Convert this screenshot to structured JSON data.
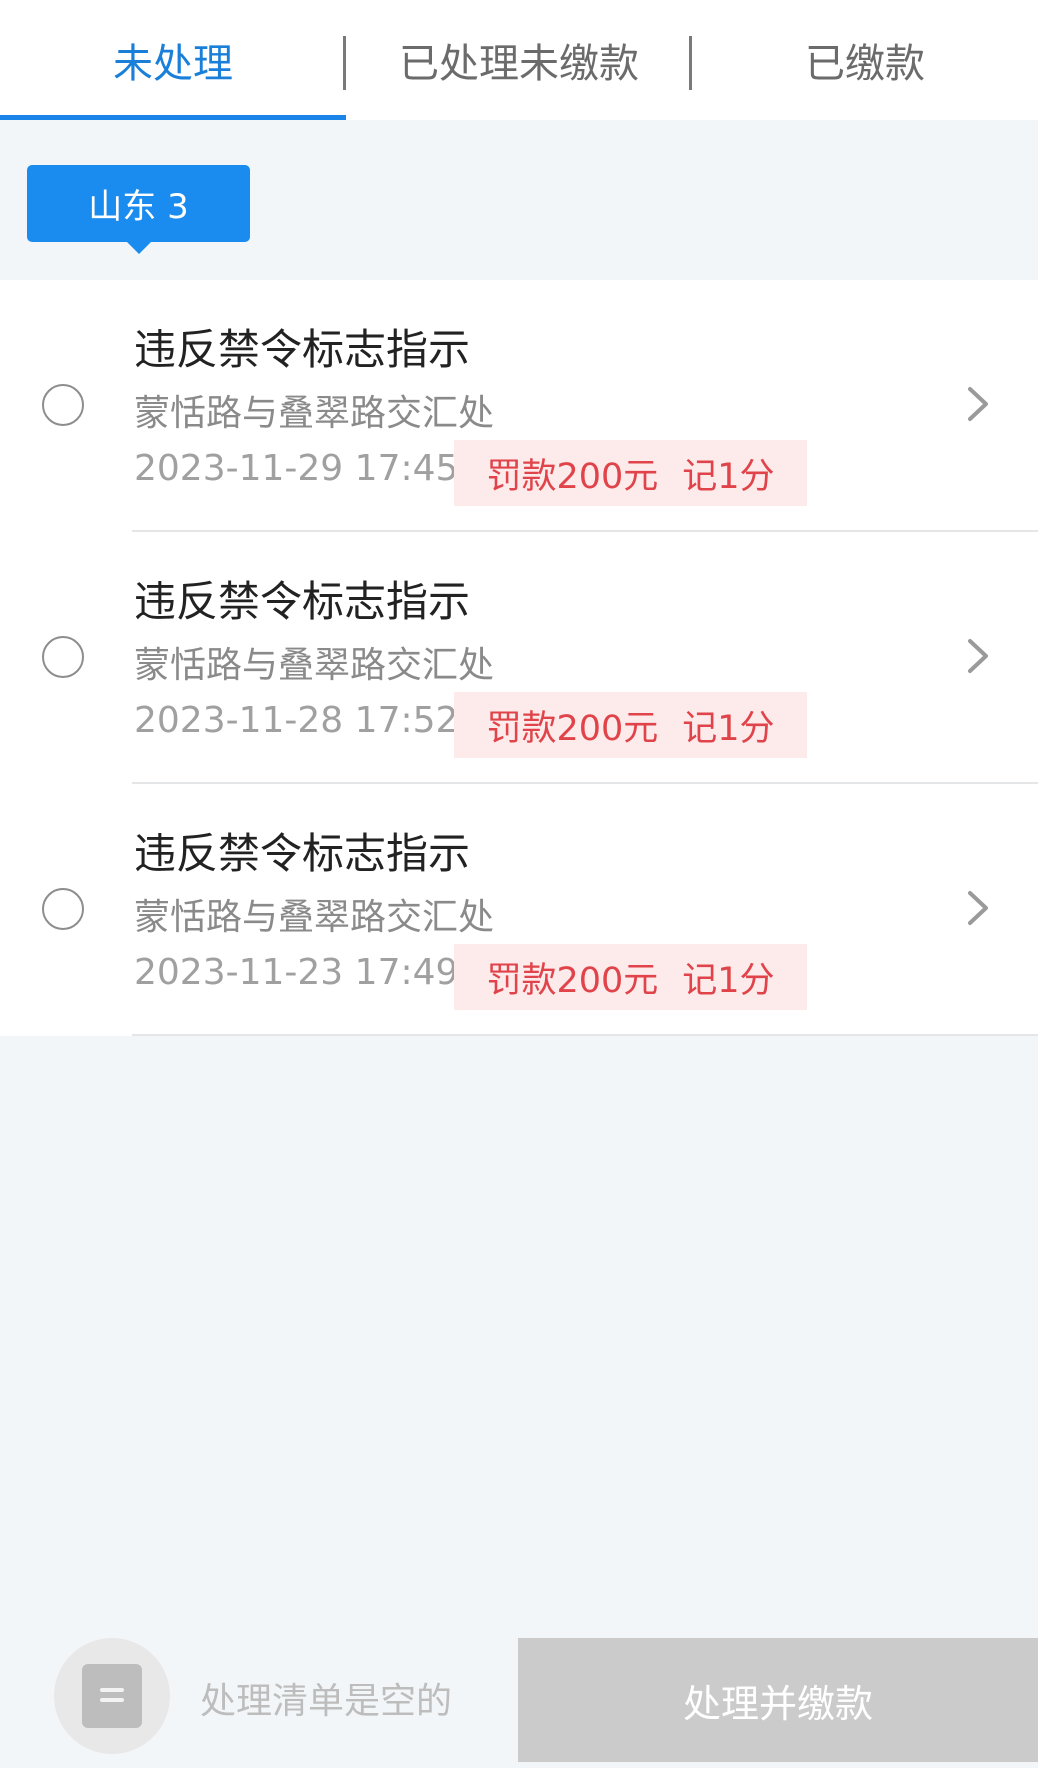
{
  "tabs": [
    {
      "label": "未处理",
      "active": true
    },
    {
      "label": "已处理未缴款",
      "active": false
    },
    {
      "label": "已缴款",
      "active": false
    }
  ],
  "region_chip": {
    "label": "山东 3"
  },
  "violations": [
    {
      "title": "违反禁令标志指示",
      "location": "蒙恬路与叠翠路交汇处",
      "datetime": "2023-11-29 17:45",
      "fine": "罚款200元",
      "points": "记1分"
    },
    {
      "title": "违反禁令标志指示",
      "location": "蒙恬路与叠翠路交汇处",
      "datetime": "2023-11-28 17:52",
      "fine": "罚款200元",
      "points": "记1分"
    },
    {
      "title": "违反禁令标志指示",
      "location": "蒙恬路与叠翠路交汇处",
      "datetime": "2023-11-23 17:49",
      "fine": "罚款200元",
      "points": "记1分"
    }
  ],
  "bottom_bar": {
    "empty_text": "处理清单是空的",
    "pay_button_label": "处理并缴款"
  },
  "colors": {
    "accent": "#1a84e8",
    "fine_text": "#e0444a",
    "fine_bg": "#fdeaea",
    "disabled_button": "#cbcbcb"
  }
}
